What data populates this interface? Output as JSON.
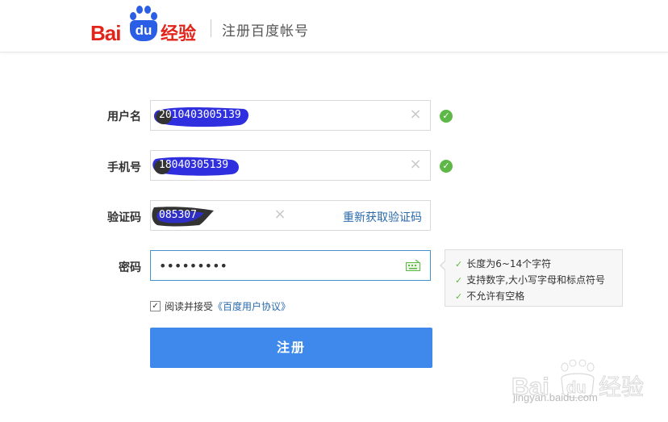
{
  "header": {
    "logo_bai": "Bai",
    "logo_du": "du",
    "logo_jingyan": "经验",
    "title": "注册百度帐号"
  },
  "form": {
    "username": {
      "label": "用户名",
      "value": "2010403005139"
    },
    "phone": {
      "label": "手机号",
      "value": "18040305139"
    },
    "code": {
      "label": "验证码",
      "value": "085307",
      "resend": "重新获取验证码"
    },
    "password": {
      "label": "密码",
      "value": "•••••••••"
    }
  },
  "password_tips": [
    "长度为6~14个字符",
    "支持数字,大小写字母和标点符号",
    "不允许有空格"
  ],
  "agreement": {
    "checked": true,
    "text": "阅读并接受",
    "link": "《百度用户协议》"
  },
  "submit_label": "注册",
  "watermark": {
    "logo": "Baidu经验",
    "url": "jingyan.baidu.com"
  },
  "colors": {
    "brand_red": "#e1251b",
    "brand_blue": "#2b5ee7",
    "button": "#3f89ec",
    "ok_green": "#5eb847",
    "link": "#2a6aab"
  }
}
